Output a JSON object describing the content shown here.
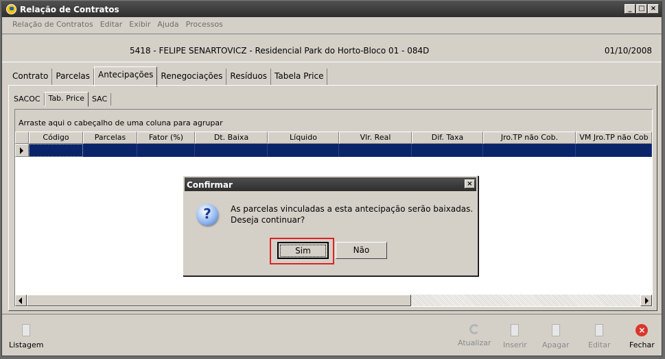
{
  "window": {
    "title": "Relação de Contratos"
  },
  "menu": [
    "Relação de Contratos",
    "Editar",
    "Exibir",
    "Ajuda",
    "Processos"
  ],
  "info": {
    "contract": "5418 - FELIPE SENARTOVICZ - Residencial Park do Horto-Bloco 01 - 084D",
    "date": "01/10/2008"
  },
  "tabs": [
    "Contrato",
    "Parcelas",
    "Antecipações",
    "Renegociações",
    "Resíduos",
    "Tabela Price"
  ],
  "active_tab": "Antecipações",
  "subtabs": [
    "SACOC",
    "Tab. Price",
    "SAC"
  ],
  "active_subtab": "Tab. Price",
  "grid": {
    "group_hint": "Arraste aqui o cabeçalho de uma coluna para agrupar",
    "columns": [
      "Código",
      "Parcelas",
      "Fator (%)",
      "Dt. Baixa",
      "Líquido",
      "Vlr. Real",
      "Dif. Taxa",
      "Jro.TP não Cob.",
      "VM Jro.TP não Cob"
    ]
  },
  "dialog": {
    "title": "Confirmar",
    "line1": "As parcelas vinculadas a esta antecipação serão baixadas.",
    "line2": "Deseja continuar?",
    "yes": "Sim",
    "no": "Não"
  },
  "toolbar": {
    "listagem": "Listagem",
    "atualizar": "Atualizar",
    "inserir": "Inserir",
    "apagar": "Apagar",
    "editar": "Editar",
    "fechar": "Fechar"
  },
  "colors": {
    "title_bar": "#3a3a3a",
    "selection": "#0a246a",
    "highlight": "#e02020",
    "face": "#d4d0c8"
  }
}
